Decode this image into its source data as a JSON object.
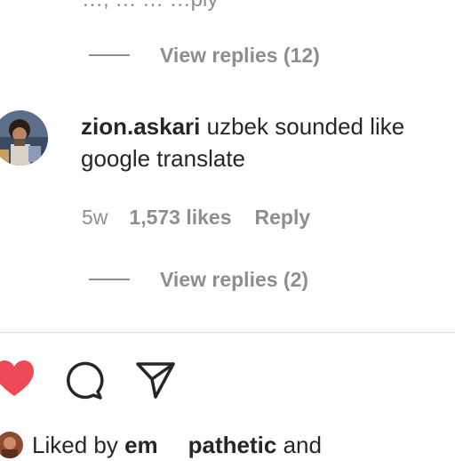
{
  "top_clipped": {
    "text": "…, … … …ply"
  },
  "thread_replies_1": {
    "label": "View replies (12)"
  },
  "comment": {
    "username": "zion.askari",
    "text": "uzbek sounded like google translate",
    "time": "5w",
    "likes": "1,573 likes",
    "reply_label": "Reply"
  },
  "thread_replies_2": {
    "label": "View replies (2)"
  },
  "actions": {
    "like_icon": "heart-filled-icon",
    "comment_icon": "comment-bubble-icon",
    "share_icon": "paper-plane-icon",
    "like_color": "#ed4956"
  },
  "liked_by": {
    "prefix": "Liked by",
    "user1": "em",
    "user2": "pathetic",
    "suffix": "and"
  },
  "colors": {
    "text_primary": "#262626",
    "text_secondary": "#8e8e8e",
    "divider": "#dbdbdb"
  }
}
